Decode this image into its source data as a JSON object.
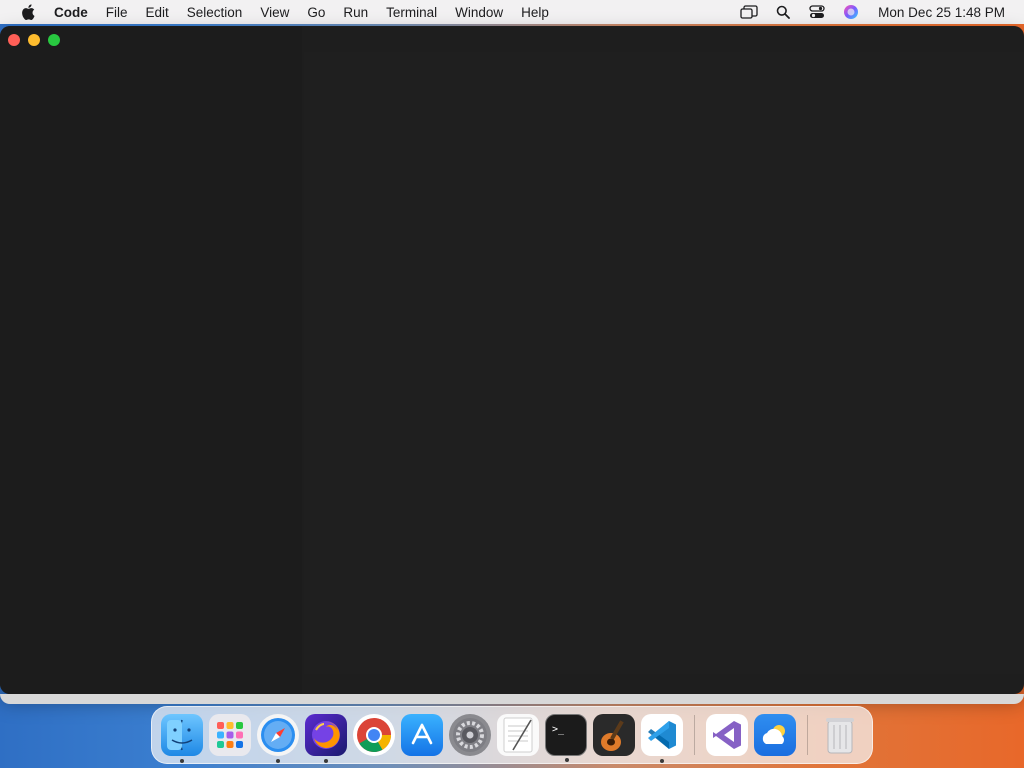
{
  "menubar": {
    "app_name": "Code",
    "items": [
      "File",
      "Edit",
      "Selection",
      "View",
      "Go",
      "Run",
      "Terminal",
      "Window",
      "Help"
    ],
    "clock": "Mon Dec 25  1:48 PM"
  },
  "window": {
    "title": ""
  },
  "dock": {
    "apps": [
      "Finder",
      "Launchpad",
      "Safari",
      "Firefox",
      "Google Chrome",
      "App Store",
      "System Settings",
      "TextEdit",
      "Terminal",
      "GarageBand",
      "Visual Studio Code"
    ],
    "extras": [
      "Visual Studio",
      "Weather"
    ],
    "trash": "Trash"
  },
  "colors": {
    "menubar_bg": "#f2f1f2",
    "window_bg": "#1e1e1e",
    "close": "#ff5f57",
    "minimize": "#febc2e",
    "maximize": "#28c840"
  }
}
